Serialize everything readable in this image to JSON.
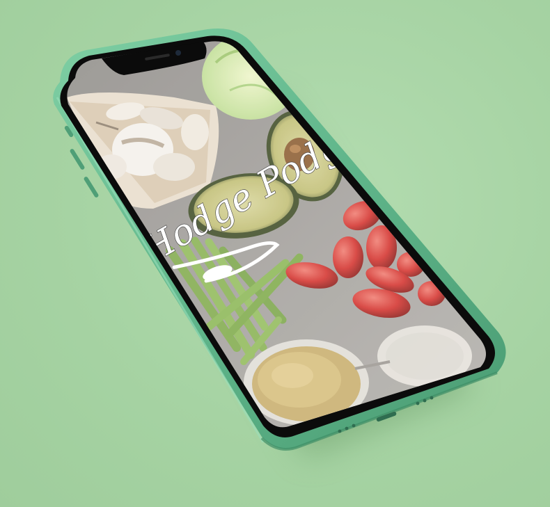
{
  "app": {
    "brand_name": "Hodge Podge",
    "screen": "splash"
  },
  "device": {
    "frame_color": "#5fb58a",
    "background_color": "#a8d5a6"
  },
  "icons": {
    "brand_logo": "hodge-podge-logo-with-spoon-swoosh"
  }
}
